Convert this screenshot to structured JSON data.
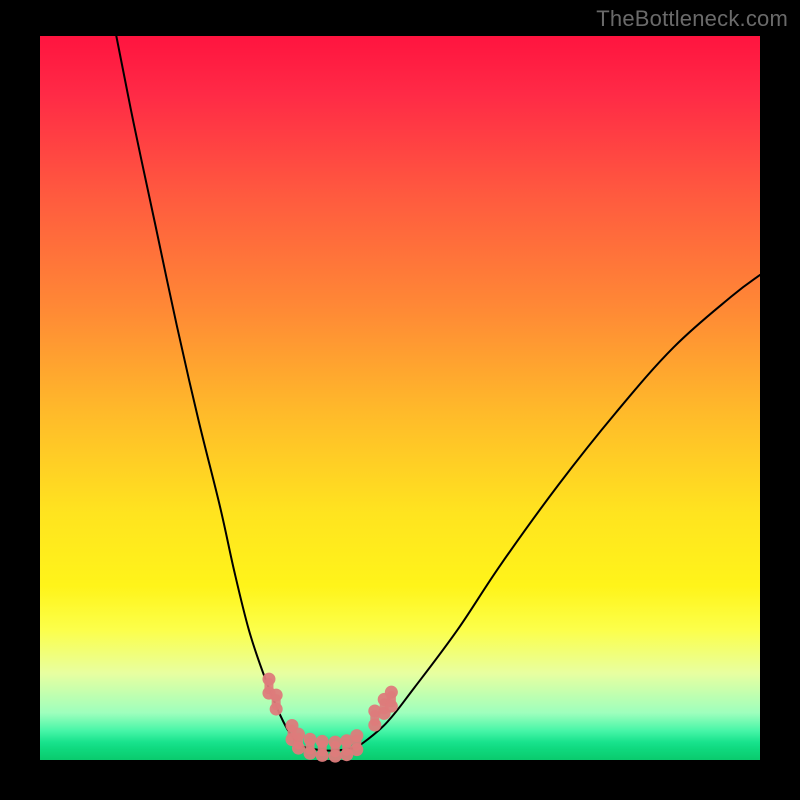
{
  "watermark": "TheBottleneck.com",
  "colors": {
    "frame": "#000000",
    "curve": "#000000",
    "marker_fill": "#dd7b7b",
    "marker_glow": "#e08a88"
  },
  "chart_data": {
    "type": "line",
    "title": "",
    "xlabel": "",
    "ylabel": "",
    "xlim": [
      0,
      100
    ],
    "ylim": [
      0,
      100
    ],
    "note": "No axes, ticks, or numeric labels are rendered; all values below are estimated from pixel positions on a 0–100 normalized grid where (0,0) is bottom-left of the colored plot.",
    "series": [
      {
        "name": "left-branch",
        "x": [
          10.6,
          13,
          16,
          19,
          22,
          25,
          27,
          29,
          31,
          33,
          34.5,
          36
        ],
        "y": [
          100,
          88,
          74,
          60,
          47,
          35,
          26,
          18,
          12,
          7,
          4,
          2
        ]
      },
      {
        "name": "floor",
        "x": [
          36,
          38,
          40,
          42,
          44
        ],
        "y": [
          2,
          1.5,
          1.3,
          1.4,
          1.7
        ]
      },
      {
        "name": "right-branch",
        "x": [
          44,
          48,
          52,
          58,
          64,
          72,
          80,
          88,
          96,
          100
        ],
        "y": [
          1.7,
          5,
          10,
          18,
          27,
          38,
          48,
          57,
          64,
          67
        ]
      }
    ],
    "markers": {
      "name": "band-dots",
      "note": "Salmon rounded-dumbbell markers clustered near the trough on both branches.",
      "points": [
        {
          "x": 31.8,
          "y": 10.2
        },
        {
          "x": 32.8,
          "y": 8.0
        },
        {
          "x": 35.0,
          "y": 3.8
        },
        {
          "x": 35.9,
          "y": 2.6
        },
        {
          "x": 37.5,
          "y": 1.9
        },
        {
          "x": 39.2,
          "y": 1.6
        },
        {
          "x": 41.0,
          "y": 1.5
        },
        {
          "x": 42.6,
          "y": 1.7
        },
        {
          "x": 44.0,
          "y": 2.4
        },
        {
          "x": 46.5,
          "y": 5.8
        },
        {
          "x": 47.8,
          "y": 7.4
        },
        {
          "x": 48.8,
          "y": 8.4
        }
      ]
    }
  }
}
